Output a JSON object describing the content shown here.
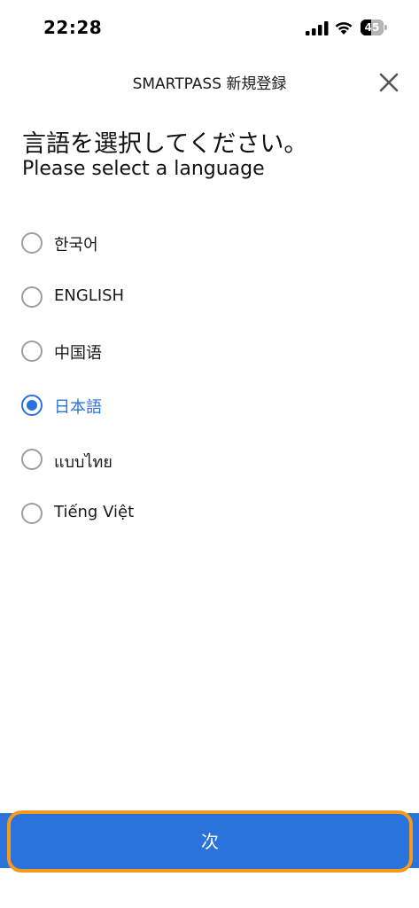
{
  "status_bar": {
    "time": "22:28",
    "battery_level": "45",
    "icons": [
      "signal-icon",
      "wifi-icon",
      "battery-icon"
    ]
  },
  "header": {
    "title": "SMARTPASS 新規登録",
    "close_icon": "close-icon"
  },
  "heading": {
    "japanese": "言語を選択してください。",
    "english": "Please select a language"
  },
  "languages": [
    {
      "label": "한국어",
      "selected": false
    },
    {
      "label": "ENGLISH",
      "selected": false
    },
    {
      "label": "中国语",
      "selected": false
    },
    {
      "label": "日本語",
      "selected": true
    },
    {
      "label": "แบบไทย",
      "selected": false
    },
    {
      "label": "Tiếng Việt",
      "selected": false
    }
  ],
  "footer": {
    "next_label": "次"
  },
  "colors": {
    "accent": "#2a73dc",
    "highlight_border": "#f59a1b",
    "radio_border": "#9e9e9e"
  }
}
